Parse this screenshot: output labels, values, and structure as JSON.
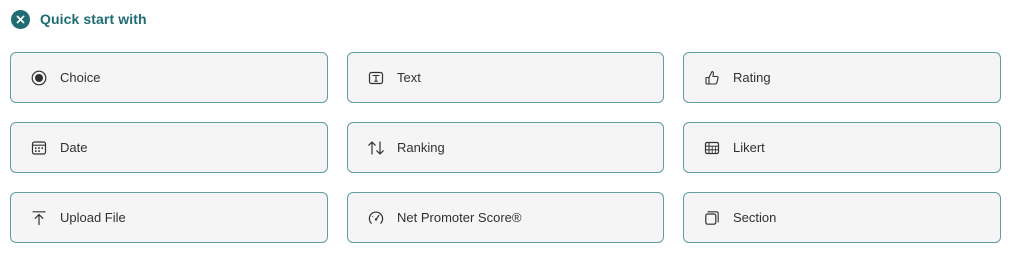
{
  "header": {
    "title": "Quick start with",
    "icon": "close-circle-icon",
    "accent_color": "#1f6b73"
  },
  "options": [
    {
      "label": "Choice",
      "icon": "radio-button-icon"
    },
    {
      "label": "Text",
      "icon": "text-box-icon"
    },
    {
      "label": "Rating",
      "icon": "thumbs-up-icon"
    },
    {
      "label": "Date",
      "icon": "calendar-icon"
    },
    {
      "label": "Ranking",
      "icon": "up-down-arrows-icon"
    },
    {
      "label": "Likert",
      "icon": "likert-grid-icon"
    },
    {
      "label": "Upload File",
      "icon": "upload-icon"
    },
    {
      "label": "Net Promoter Score®",
      "icon": "gauge-icon"
    },
    {
      "label": "Section",
      "icon": "section-icon"
    }
  ],
  "colors": {
    "card_background": "#f5f5f5",
    "card_border": "#5f9ea3",
    "text": "#323130",
    "icon": "#323130"
  }
}
